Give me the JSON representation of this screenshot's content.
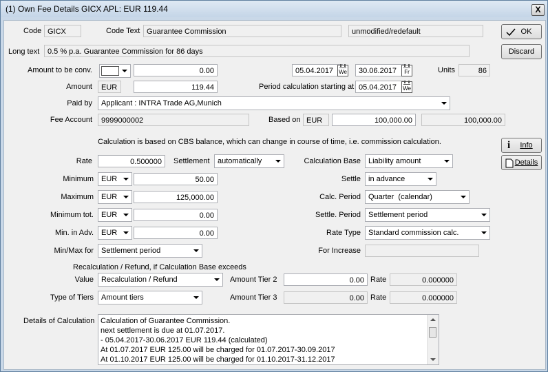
{
  "window": {
    "title": "(1) Own Fee Details GICX APL: EUR 119.44",
    "close": "X"
  },
  "labels": {
    "code": "Code",
    "code_text": "Code Text",
    "long_text": "Long text",
    "amount_to_conv": "Amount to be conv.",
    "units": "Units",
    "amount": "Amount",
    "period_calc": "Period calculation starting at",
    "paid_by": "Paid by",
    "fee_account": "Fee Account",
    "based_on": "Based on",
    "cbs_note": "Calculation is based on CBS balance, which can change in course of time, i.e. commission calculation.",
    "rate": "Rate",
    "settlement": "Settlement",
    "calc_base": "Calculation Base",
    "minimum": "Minimum",
    "settle": "Settle",
    "maximum": "Maximum",
    "calc_period": "Calc. Period",
    "minimum_tot": "Minimum tot.",
    "settle_period": "Settle. Period",
    "min_in_adv": "Min. in Adv.",
    "rate_type": "Rate Type",
    "min_max_for": "Min/Max for",
    "for_increase": "For Increase",
    "recalc_heading": "Recalculation / Refund, if Calculation Base exceeds",
    "value": "Value",
    "amount_tier2": "Amount Tier 2",
    "rate2": "Rate",
    "type_of_tiers": "Type of Tiers",
    "amount_tier3": "Amount Tier 3",
    "rate3": "Rate",
    "details_of_calc": "Details of Calculation"
  },
  "buttons": {
    "ok": "OK",
    "discard": "Discard",
    "info": "Info",
    "details": "Details"
  },
  "fields": {
    "code": "GICX",
    "code_text": "Guarantee Commission",
    "status": "unmodified/redefault",
    "long_text": "0.5 % p.a. Guarantee Commission for 86 days",
    "amount_conv_ccy": "",
    "amount_conv": "0.00",
    "date_from": "05.04.2017",
    "date_from_day": "We",
    "date_to": "30.06.2017",
    "date_to_day": "Fr",
    "units": "86",
    "amount_ccy": "EUR",
    "amount": "119.44",
    "period_start": "05.04.2017",
    "period_start_day": "We",
    "paid_by": "Applicant : INTRA Trade AG,Munich",
    "fee_account": "9999000002",
    "based_on_ccy": "EUR",
    "based_on_amount": "100,000.00",
    "based_on_amount2": "100,000.00",
    "rate": "0.500000",
    "settlement": "automatically",
    "calc_base": "Liability amount",
    "min_ccy": "EUR",
    "minimum": "50.00",
    "settle": "in advance",
    "max_ccy": "EUR",
    "maximum": "125,000.00",
    "calc_period": "Quarter  (calendar)",
    "mintot_ccy": "EUR",
    "minimum_tot": "0.00",
    "settle_period": "Settlement period",
    "minadv_ccy": "EUR",
    "min_in_adv": "0.00",
    "rate_type": "Standard commission calc.",
    "min_max_for": "Settlement period",
    "for_increase": "",
    "value": "Recalculation / Refund",
    "amount_tier2": "0.00",
    "rate_tier2": "0.000000",
    "type_of_tiers": "Amount tiers",
    "amount_tier3": "0.00",
    "rate_tier3": "0.000000"
  },
  "details_lines": [
    "Calculation of Guarantee Commission.",
    "next settlement is due at 01.07.2017.",
    "- 05.04.2017-30.06.2017 EUR 119.44 (calculated)",
    "At 01.07.2017 EUR 125.00 will be charged for 01.07.2017-30.09.2017",
    "At 01.10.2017 EUR 125.00 will be charged for 01.10.2017-31.12.2017"
  ]
}
